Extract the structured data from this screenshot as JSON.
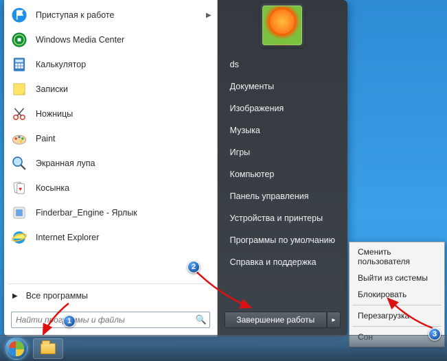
{
  "programs": [
    {
      "label": "Приступая к работе",
      "name": "getting-started",
      "chevron": true,
      "icon": "flag"
    },
    {
      "label": "Windows Media Center",
      "name": "media-center",
      "icon": "wmc"
    },
    {
      "label": "Калькулятор",
      "name": "calculator",
      "icon": "calc"
    },
    {
      "label": "Записки",
      "name": "sticky-notes",
      "icon": "note"
    },
    {
      "label": "Ножницы",
      "name": "snipping-tool",
      "icon": "scissors"
    },
    {
      "label": "Paint",
      "name": "paint",
      "icon": "paint"
    },
    {
      "label": "Экранная лупа",
      "name": "magnifier",
      "icon": "magnifier"
    },
    {
      "label": "Косынка",
      "name": "solitaire",
      "icon": "cards"
    },
    {
      "label": "Finderbar_Engine - Ярлык",
      "name": "finderbar-shortcut",
      "icon": "generic"
    },
    {
      "label": "Internet Explorer",
      "name": "internet-explorer",
      "icon": "ie"
    }
  ],
  "all_programs_label": "Все программы",
  "search": {
    "placeholder": "Найти программы и файлы"
  },
  "right_items": [
    {
      "label": "ds",
      "name": "user-folder"
    },
    {
      "label": "Документы",
      "name": "documents"
    },
    {
      "label": "Изображения",
      "name": "pictures"
    },
    {
      "label": "Музыка",
      "name": "music"
    },
    {
      "label": "Игры",
      "name": "games"
    },
    {
      "label": "Компьютер",
      "name": "computer"
    },
    {
      "label": "Панель управления",
      "name": "control-panel"
    },
    {
      "label": "Устройства и принтеры",
      "name": "devices-printers"
    },
    {
      "label": "Программы по умолчанию",
      "name": "default-programs"
    },
    {
      "label": "Справка и поддержка",
      "name": "help-support"
    }
  ],
  "shutdown_label": "Завершение работы",
  "power_menu": [
    {
      "label": "Сменить пользователя",
      "name": "switch-user"
    },
    {
      "label": "Выйти из системы",
      "name": "log-off"
    },
    {
      "label": "Блокировать",
      "name": "lock"
    },
    {
      "sep": true
    },
    {
      "label": "Перезагрузка",
      "name": "restart"
    },
    {
      "sep": true
    },
    {
      "label": "Сон",
      "name": "sleep"
    }
  ],
  "badges": {
    "b1": "1",
    "b2": "2",
    "b3": "3"
  }
}
